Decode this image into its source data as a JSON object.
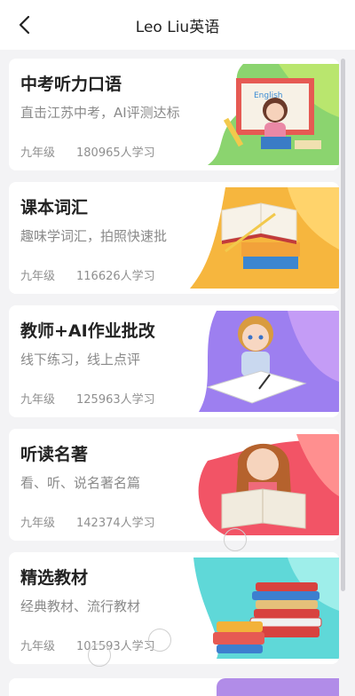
{
  "header": {
    "title": "Leo Liu英语"
  },
  "courses": [
    {
      "title": "中考听力口语",
      "subtitle": "直击江苏中考，AI评测达标",
      "grade": "九年级",
      "learners": "180965人学习",
      "colors": [
        "#7ed36d",
        "#c3e96a"
      ]
    },
    {
      "title": "课本词汇",
      "subtitle": "趣味学词汇，拍照快速批",
      "grade": "九年级",
      "learners": "116626人学习",
      "colors": [
        "#f4b23d",
        "#ffd86a"
      ]
    },
    {
      "title": "教师+AI作业批改",
      "subtitle": "线下练习，线上点评",
      "grade": "九年级",
      "learners": "125963人学习",
      "colors": [
        "#9a7cf0",
        "#c39cf5"
      ]
    },
    {
      "title": "听读名著",
      "subtitle": "看、听、说名著名篇",
      "grade": "九年级",
      "learners": "142374人学习",
      "colors": [
        "#f25667",
        "#ff8a8a"
      ]
    },
    {
      "title": "精选教材",
      "subtitle": "经典教材、流行教材",
      "grade": "九年级",
      "learners": "101593人学习",
      "colors": [
        "#5fd9da",
        "#8eecea"
      ]
    }
  ]
}
